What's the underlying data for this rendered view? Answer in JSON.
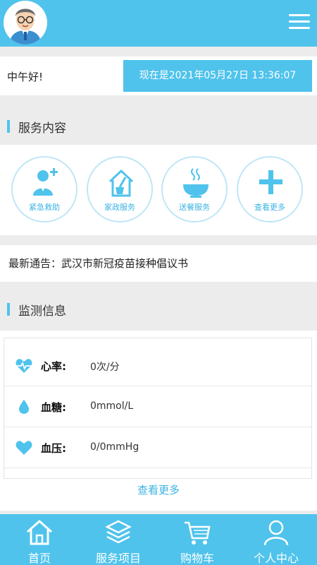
{
  "header": {
    "avatar_icon": "doctor-avatar-icon",
    "menu_icon": "hamburger-menu-icon"
  },
  "greeting": {
    "text": "中午好!",
    "time": "现在是2021年05月27日 13:36:07"
  },
  "services": {
    "title": "服务内容",
    "items": [
      {
        "label": "紧急救助",
        "icon": "doctor-plus-icon"
      },
      {
        "label": "家政服务",
        "icon": "house-broom-icon"
      },
      {
        "label": "送餐服务",
        "icon": "food-bowl-icon"
      },
      {
        "label": "查看更多",
        "icon": "plus-icon"
      }
    ]
  },
  "notice": {
    "text": "最新通告：武汉市新冠疫苗接种倡议书"
  },
  "monitor": {
    "title": "监测信息",
    "rows": [
      {
        "name": "心率:",
        "value": "0次/分",
        "icon": "heart-pulse-icon"
      },
      {
        "name": "血糖:",
        "value": "0mmol/L",
        "icon": "droplet-icon"
      },
      {
        "name": "血压:",
        "value": "0/0mmHg",
        "icon": "heart-icon"
      }
    ],
    "more": "查看更多"
  },
  "tabbar": {
    "items": [
      {
        "label": "首页",
        "icon": "home-icon"
      },
      {
        "label": "服务项目",
        "icon": "layers-icon"
      },
      {
        "label": "购物车",
        "icon": "cart-icon"
      },
      {
        "label": "个人中心",
        "icon": "user-icon"
      }
    ]
  },
  "colors": {
    "accent": "#4fc3ec",
    "accent_text": "#3bb3e3",
    "background": "#ececec"
  }
}
